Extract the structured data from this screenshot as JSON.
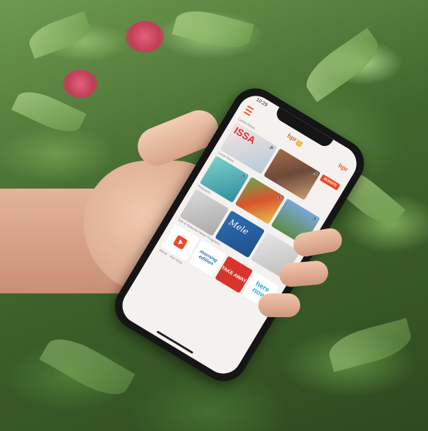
{
  "scene": {
    "description_tag": "hand-holding-phone-over-foliage"
  },
  "phone": {
    "status_time": "10:29",
    "app": {
      "logo_text": "hpr",
      "logo_badge": "1",
      "header_logo_2": "hpr",
      "donate_label": "DONATE",
      "sections": {
        "latest_news": "Latest News",
        "local_news": "Local News",
        "podcasts": "Podcasts",
        "programs": "Talk & National News Programs",
        "music": "Music · Arts Now"
      },
      "tiles": {
        "issa_title": "ISSA",
        "mele_title": "Mele"
      },
      "programs": {
        "morning_edition": "morning edition",
        "take_away": "TAKE AWAY",
        "here_now": "here now"
      }
    }
  },
  "colors": {
    "brand_orange": "#e95a2b",
    "donate_red": "#e94b2c",
    "phone_black": "#151515"
  }
}
